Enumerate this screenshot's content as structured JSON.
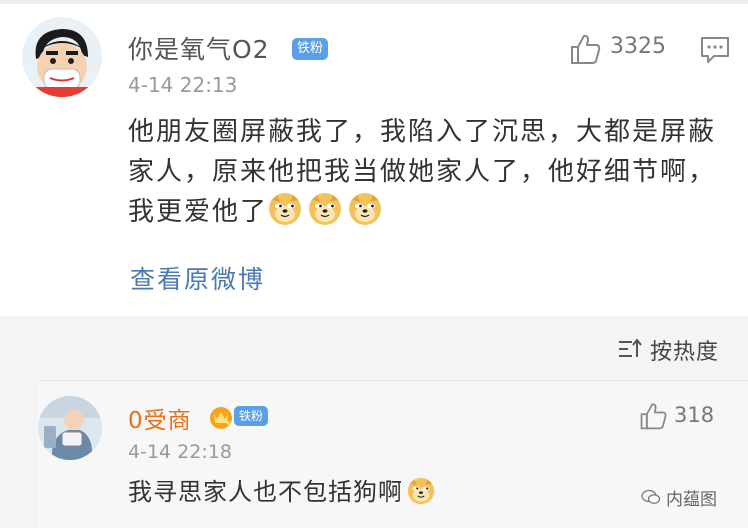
{
  "main_comment": {
    "username": "你是氧气O2",
    "badge": "铁粉",
    "like_count": "3325",
    "time": "4-14 22:13",
    "text": "他朋友圈屏蔽我了，我陷入了沉思，大都是屏蔽家人，原来他把我当做她家人了，他好细节啊，我更爱他了",
    "emojis": [
      "doge-emoji",
      "doge-emoji",
      "doge-emoji"
    ],
    "view_source": "查看原微博"
  },
  "sort": {
    "label": "按热度"
  },
  "reply": {
    "username": "0受商",
    "badge": "铁粉",
    "crown_level": "5",
    "like_count": "318",
    "time": "4-14 22:18",
    "text": "我寻思家人也不包括狗啊"
  },
  "watermark": {
    "text": "内蕴图"
  },
  "colors": {
    "badge": "#5aa0e6",
    "link": "#4a7ab0",
    "reply_name": "#e8701a"
  }
}
